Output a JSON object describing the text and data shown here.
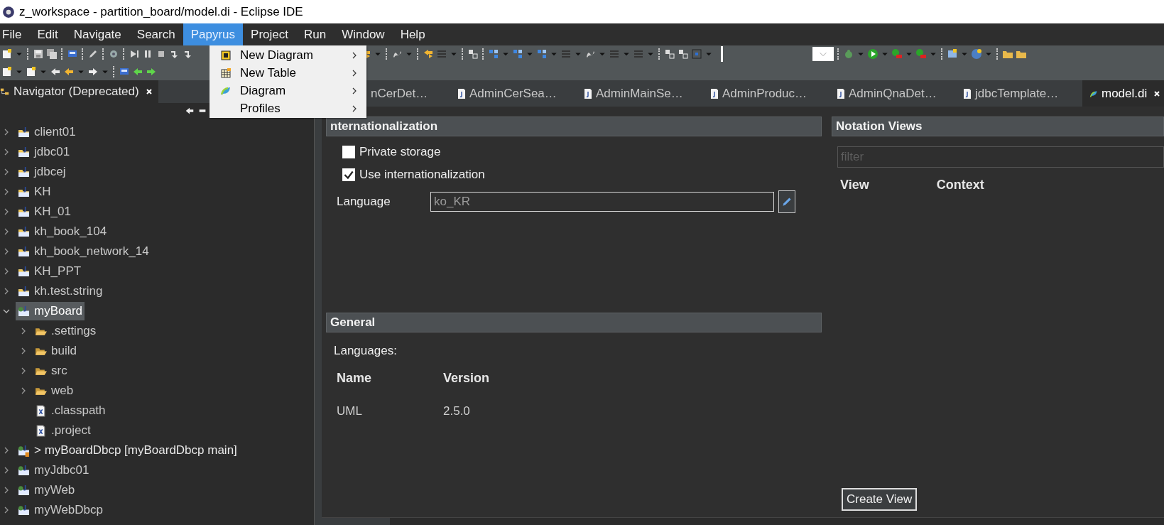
{
  "window": {
    "title": "z_workspace - partition_board/model.di - Eclipse IDE"
  },
  "menubar": [
    {
      "label": "File",
      "selected": false
    },
    {
      "label": "Edit",
      "selected": false
    },
    {
      "label": "Navigate",
      "selected": false
    },
    {
      "label": "Search",
      "selected": false
    },
    {
      "label": "Papyrus",
      "selected": true
    },
    {
      "label": "Project",
      "selected": false
    },
    {
      "label": "Run",
      "selected": false
    },
    {
      "label": "Window",
      "selected": false
    },
    {
      "label": "Help",
      "selected": false
    }
  ],
  "papyrus_menu": [
    {
      "label": "New Diagram",
      "kind": "diagram"
    },
    {
      "label": "New Table",
      "kind": "table"
    },
    {
      "label": "Diagram",
      "kind": "papyrus"
    },
    {
      "label": "Profiles",
      "kind": "none"
    }
  ],
  "navigator": {
    "title": "Navigator (Deprecated)"
  },
  "tree": [
    {
      "label": "client01",
      "kind": "java-project",
      "expanded": false,
      "selected": false
    },
    {
      "label": "jdbc01",
      "kind": "java-project",
      "expanded": false,
      "selected": false
    },
    {
      "label": "jdbcej",
      "kind": "java-project",
      "expanded": false,
      "selected": false
    },
    {
      "label": "KH",
      "kind": "java-project",
      "expanded": false,
      "selected": false
    },
    {
      "label": "KH_01",
      "kind": "java-project",
      "expanded": false,
      "selected": false
    },
    {
      "label": "kh_book_104",
      "kind": "java-project",
      "expanded": false,
      "selected": false
    },
    {
      "label": "kh_book_network_14",
      "kind": "java-project",
      "expanded": false,
      "selected": false
    },
    {
      "label": "KH_PPT",
      "kind": "java-project",
      "expanded": false,
      "selected": false
    },
    {
      "label": "kh.test.string",
      "kind": "java-project",
      "expanded": false,
      "selected": false
    },
    {
      "label": "myBoard",
      "kind": "web-project",
      "expanded": true,
      "selected": true,
      "children": [
        {
          "label": ".settings",
          "kind": "folder",
          "expanded": false,
          "selected": false
        },
        {
          "label": "build",
          "kind": "folder",
          "expanded": false,
          "selected": false
        },
        {
          "label": "src",
          "kind": "folder",
          "expanded": false,
          "selected": false
        },
        {
          "label": "web",
          "kind": "folder",
          "expanded": false,
          "selected": false
        },
        {
          "label": ".classpath",
          "kind": "file",
          "selected": false
        },
        {
          "label": ".project",
          "kind": "file",
          "selected": false
        }
      ]
    },
    {
      "label": "> myBoardDbcp [myBoardDbcp main]",
      "kind": "repo-project",
      "expanded": false,
      "selected": false
    },
    {
      "label": "myJdbc01",
      "kind": "web-project",
      "expanded": false,
      "selected": false
    },
    {
      "label": "myWeb",
      "kind": "web-project",
      "expanded": false,
      "selected": false
    },
    {
      "label": "myWebDbcp",
      "kind": "web-project",
      "expanded": false,
      "selected": false
    }
  ],
  "editor_tabs": [
    {
      "label": "nCerDet…",
      "kind": "partial",
      "selected": false
    },
    {
      "label": "AdminCerSea…",
      "kind": "java",
      "selected": false
    },
    {
      "label": "AdminMainSe…",
      "kind": "java",
      "selected": false
    },
    {
      "label": "AdminProduc…",
      "kind": "java",
      "selected": false
    },
    {
      "label": "AdminQnaDet…",
      "kind": "java",
      "selected": false
    },
    {
      "label": "jdbcTemplate…",
      "kind": "java",
      "selected": false
    },
    {
      "label": "model.di",
      "kind": "model",
      "selected": true
    }
  ],
  "internationalization": {
    "title": "nternationalization",
    "options": [
      {
        "label": "Private storage",
        "checked": false
      },
      {
        "label": "Use internationalization",
        "checked": true
      }
    ],
    "language": {
      "label": "Language",
      "value": "ko_KR"
    }
  },
  "general": {
    "title": "General",
    "languages_label": "Languages:",
    "columns": [
      "Name",
      "Version"
    ],
    "rows": [
      [
        "UML",
        "2.5.0"
      ]
    ]
  },
  "notation_views": {
    "title": "Notation Views",
    "filter": {
      "placeholder": "filter"
    },
    "columns": [
      "View",
      "Context"
    ],
    "button": "Create View"
  }
}
